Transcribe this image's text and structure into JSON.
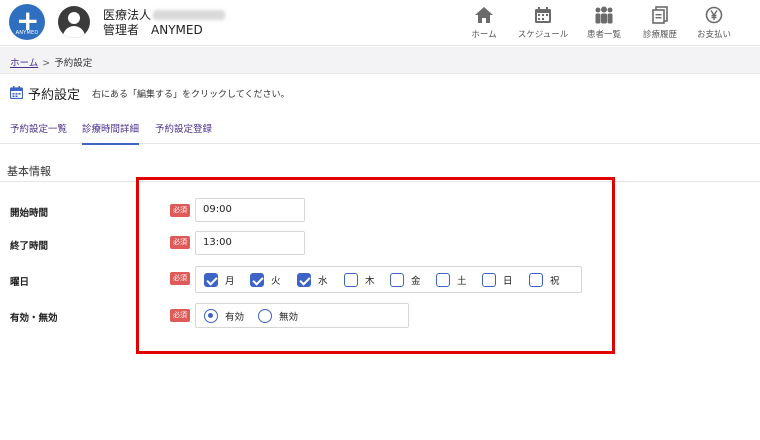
{
  "header": {
    "logo_text": "ANYMED",
    "org_name": "医療法人",
    "role": "管理者",
    "user": "ANYMED",
    "nav": [
      {
        "label": "ホーム",
        "icon": "home-icon"
      },
      {
        "label": "スケジュール",
        "icon": "calendar-icon"
      },
      {
        "label": "患者一覧",
        "icon": "patients-icon"
      },
      {
        "label": "診療履歴",
        "icon": "history-icon"
      },
      {
        "label": "お支払い",
        "icon": "yen-icon"
      }
    ]
  },
  "breadcrumb": {
    "home": "ホーム",
    "separator": ">",
    "current": "予約設定"
  },
  "page": {
    "title": "予約設定",
    "hint": "右にある「編集する」をクリックしてください。",
    "tabs": [
      "予約設定一覧",
      "診療時間詳細",
      "予約設定登録"
    ],
    "active_tab": "診療時間詳細",
    "section": "基本情報"
  },
  "form": {
    "required_label": "必須",
    "start_time": {
      "label": "開始時間",
      "value": "09:00"
    },
    "end_time": {
      "label": "終了時間",
      "value": "13:00"
    },
    "weekdays": {
      "label": "曜日",
      "days": [
        {
          "label": "月",
          "checked": true
        },
        {
          "label": "火",
          "checked": true
        },
        {
          "label": "水",
          "checked": true
        },
        {
          "label": "木",
          "checked": false
        },
        {
          "label": "金",
          "checked": false
        },
        {
          "label": "土",
          "checked": false
        },
        {
          "label": "日",
          "checked": false
        },
        {
          "label": "祝",
          "checked": false
        }
      ]
    },
    "status": {
      "label": "有効・無効",
      "options": [
        {
          "label": "有効",
          "selected": true
        },
        {
          "label": "無効",
          "selected": false
        }
      ]
    }
  },
  "colors": {
    "accent": "#3e63c6",
    "required": "#e05a5a",
    "highlight": "#e00000",
    "link": "#4a2f8c"
  }
}
